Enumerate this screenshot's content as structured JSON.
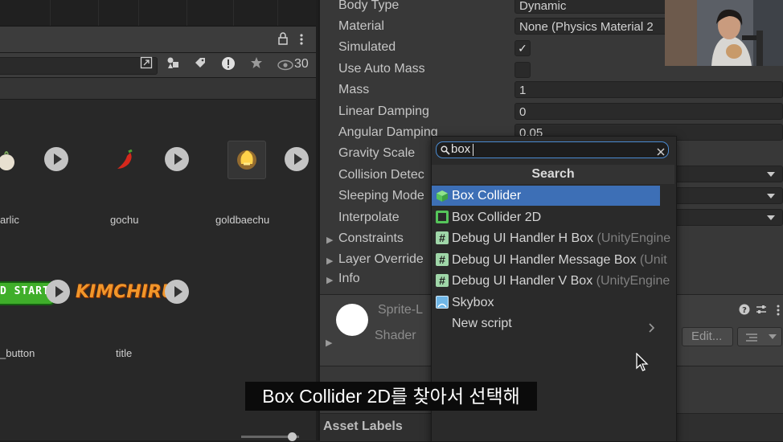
{
  "project_panel": {
    "badge_count": "30",
    "assets": [
      {
        "label": "arlic"
      },
      {
        "label": "gochu"
      },
      {
        "label": "goldbaechu"
      },
      {
        "label": "_button",
        "preview_text": "D START"
      },
      {
        "label": "title",
        "preview_text": "KIMCHIRU"
      }
    ]
  },
  "inspector": {
    "properties": [
      {
        "label": "Body Type",
        "value": "Dynamic"
      },
      {
        "label": "Material",
        "value": "None (Physics Material 2"
      },
      {
        "label": "Simulated",
        "checked": "✓"
      },
      {
        "label": "Use Auto Mass"
      },
      {
        "label": "Mass",
        "value": "1"
      },
      {
        "label": "Linear Damping",
        "value": "0"
      },
      {
        "label": "Angular Damping",
        "value": "0.05"
      },
      {
        "label": "Gravity Scale"
      },
      {
        "label": "Collision Detec"
      },
      {
        "label": "Sleeping Mode"
      },
      {
        "label": "Interpolate"
      }
    ],
    "foldouts": [
      "Constraints",
      "Layer Override",
      "Info"
    ],
    "material_header": "Sprite-L",
    "shader_label": "Shader",
    "edit_button": "Edit...",
    "asset_labels": "Asset Labels"
  },
  "add_component_popup": {
    "search_value": "box",
    "header": "Search",
    "items": [
      {
        "label": "Box Collider",
        "icon": "cube-icon",
        "selected": true
      },
      {
        "label": "Box Collider 2D",
        "icon": "square-collider-icon"
      },
      {
        "label": "Debug UI Handler H Box",
        "namespace": "(UnityEngine",
        "icon": "script-icon"
      },
      {
        "label": "Debug UI Handler Message Box",
        "namespace": "(Unit",
        "icon": "script-icon"
      },
      {
        "label": "Debug UI Handler V Box",
        "namespace": "(UnityEngine",
        "icon": "script-icon"
      },
      {
        "label": "Skybox",
        "icon": "skybox-icon"
      },
      {
        "label": "New script",
        "icon": "chevron-right-icon"
      }
    ]
  },
  "subtitle": "Box Collider 2D를 찾아서 선택해",
  "colors": {
    "selection": "#3d6fb6",
    "search_border": "#4a8ad0",
    "component_green": "#55c55a",
    "script_icon_bg": "#9fd6a8"
  }
}
